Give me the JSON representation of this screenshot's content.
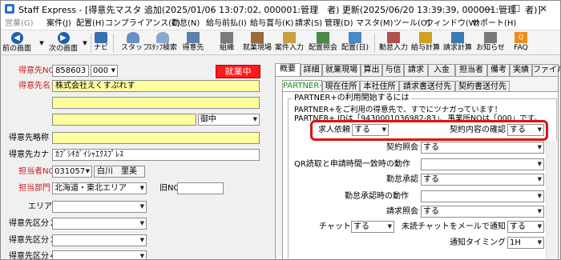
{
  "window": {
    "title": "Staff Express - [得意先マスタ  追加(2025/01/06 13:07:02, 000001:管理　者) 更新(2025/06/20 13:39:39, 000001:管理　者)]",
    "minimize": "—",
    "maximize": "☐",
    "close": "✕"
  },
  "menu": [
    "営業(G)",
    "案件(J)",
    "配置(H)",
    "コンプライアンス(C)",
    "勤怠(N)",
    "給与前払(I)",
    "給与賞与(K)",
    "請求(S)",
    "管理(D)",
    "マスタ(M)",
    "ツール(O)",
    "ウィンドウ(W)",
    "サポート(H)"
  ],
  "toolbar": {
    "back": "前の画面",
    "forward": "次の画面",
    "navi": "ナビ",
    "staff": "スタッフ",
    "staff_search": "ｽﾀｯﾌ検索",
    "client": "得意先",
    "org": "組織",
    "site": "就業現場",
    "case_entry": "案件入力",
    "deploy_inquiry": "配置照会",
    "deploy_day": "配置(日)",
    "attendance_entry": "勤怠入力",
    "payroll_calc": "給与計算",
    "billing_calc": "請求計算",
    "notice": "お知らせ",
    "faq": "FAQ"
  },
  "form": {
    "client_no_label": "得意先NO",
    "client_no": "858603",
    "client_branch": "000",
    "status_badge": "就業中",
    "client_name_label": "得意先名",
    "client_name": "株式会社えくすぷれす",
    "honorific": "御中",
    "short_name_label": "得意先略称",
    "kana_label": "得意先カナ",
    "kana": "ｶﾌﾞｼｷｶﾞｲｼｬｴｸｽﾌﾟﾚｽ",
    "person_label": "担当者NO",
    "person_no": "031057",
    "person_name": "白川　里美",
    "dept_label": "担当部門",
    "dept": "北海道・東北エリア",
    "old_no_label": "旧NO",
    "area_label": "エリア",
    "kubun2_label": "得意先区分２",
    "kubun3_label": "得意先区分３",
    "kubun4_label": "得意先区分４"
  },
  "tabs": [
    "概要",
    "詳細",
    "就業現場",
    "算出",
    "与信",
    "請求",
    "入金",
    "担当者",
    "備考",
    "実績",
    "ファイル"
  ],
  "subtabs": [
    "PARTNER+",
    "現在住所",
    "本社住所",
    "請求書送付先",
    "契約書送付先"
  ],
  "partner": {
    "group_title": "PARTNER+の利用開始するには",
    "info1": "PARTNER+をご利用の得意先で、すでにツナガっています！",
    "info2": "PARTNER+ IDは「9430001036982-83」、事業所NOは「000」です。",
    "rows": [
      {
        "label": "求人依頼",
        "value": "する"
      },
      {
        "label": "契約内容の確認",
        "value": "する"
      },
      {
        "label": "契約照会",
        "value": "する"
      },
      {
        "label": "QR読取と申請時間一致時の動作",
        "value": ""
      },
      {
        "label": "勤怠承認",
        "value": "する"
      },
      {
        "label": "勤怠承認時の動作",
        "value": ""
      },
      {
        "label": "請求照会",
        "value": "する"
      },
      {
        "label": "チャット",
        "value": "する"
      },
      {
        "label": "未読チャットをメールで通知",
        "value": "する"
      },
      {
        "label": "通知タイミング",
        "value": "1H"
      }
    ]
  },
  "colors": {
    "required_label": "#d01818",
    "highlight": "#e01010",
    "active_subtab": "#1a8f1a",
    "input_yellow": "#ffffa0"
  }
}
